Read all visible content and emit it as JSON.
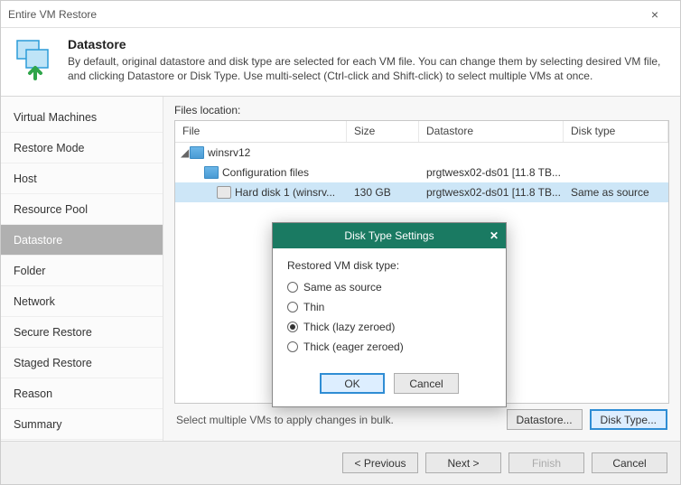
{
  "window": {
    "title": "Entire VM Restore"
  },
  "header": {
    "title": "Datastore",
    "desc": "By default, original datastore and disk type are selected for each VM file. You can change them by selecting desired VM file, and clicking Datastore or Disk Type. Use multi-select (Ctrl-click and Shift-click) to select multiple VMs at once."
  },
  "sidebar": {
    "items": [
      {
        "label": "Virtual Machines"
      },
      {
        "label": "Restore Mode"
      },
      {
        "label": "Host"
      },
      {
        "label": "Resource Pool"
      },
      {
        "label": "Datastore",
        "active": true
      },
      {
        "label": "Folder"
      },
      {
        "label": "Network"
      },
      {
        "label": "Secure Restore"
      },
      {
        "label": "Staged Restore"
      },
      {
        "label": "Reason"
      },
      {
        "label": "Summary"
      }
    ]
  },
  "main": {
    "files_label": "Files location:",
    "cols": {
      "file": "File",
      "size": "Size",
      "ds": "Datastore",
      "dt": "Disk type"
    },
    "rows": {
      "r0": {
        "name": "winsrv12"
      },
      "r1": {
        "name": "Configuration files",
        "ds": "prgtwesx02-ds01 [11.8 TB..."
      },
      "r2": {
        "name": "Hard disk 1 (winsrv...",
        "size": "130 GB",
        "ds": "prgtwesx02-ds01 [11.8 TB...",
        "dt": "Same as source"
      }
    },
    "hint": "Select multiple VMs to apply changes in bulk.",
    "btn_ds": "Datastore...",
    "btn_dt": "Disk Type..."
  },
  "dialog": {
    "title": "Disk Type Settings",
    "label": "Restored VM disk type:",
    "opts": {
      "o0": "Same as source",
      "o1": "Thin",
      "o2": "Thick (lazy zeroed)",
      "o3": "Thick (eager zeroed)"
    },
    "ok": "OK",
    "cancel": "Cancel"
  },
  "footer": {
    "prev": "< Previous",
    "next": "Next >",
    "finish": "Finish",
    "cancel": "Cancel"
  }
}
